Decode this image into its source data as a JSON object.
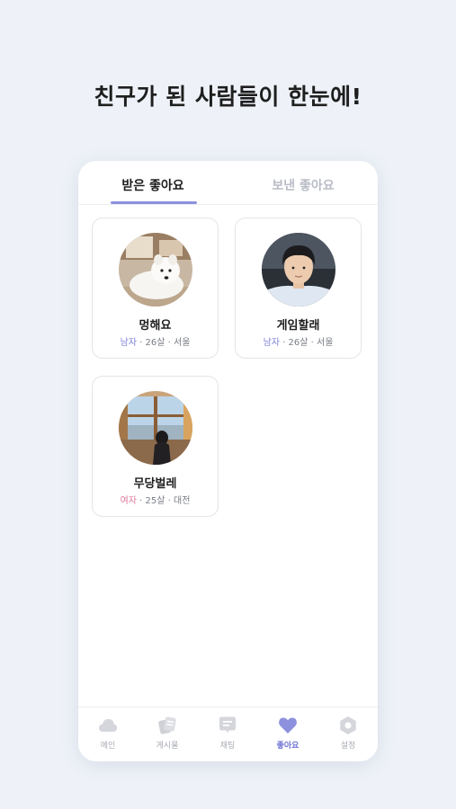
{
  "headline": "친구가 된 사람들이 한눈에!",
  "tabs": {
    "received": "받은 좋아요",
    "sent": "보낸 좋아요"
  },
  "cards": [
    {
      "name": "멍해요",
      "gender": "남자",
      "age": "26살",
      "city": "서울",
      "avatar": "samoyed-dog-photo"
    },
    {
      "name": "게임할래",
      "gender": "남자",
      "age": "26살",
      "city": "서울",
      "avatar": "young-man-car-photo"
    },
    {
      "name": "무당벌레",
      "gender": "여자",
      "age": "25살",
      "city": "대전",
      "avatar": "woman-window-view-photo"
    }
  ],
  "separator": "·",
  "nav": {
    "items": [
      {
        "label": "메인",
        "icon": "cloud-icon"
      },
      {
        "label": "게시물",
        "icon": "posts-icon"
      },
      {
        "label": "채팅",
        "icon": "chat-icon"
      },
      {
        "label": "좋아요",
        "icon": "heart-icon",
        "active": true
      },
      {
        "label": "설정",
        "icon": "hexagon-settings-icon"
      }
    ]
  },
  "colors": {
    "accent": "#8d91dd",
    "male": "#7c82d6",
    "female": "#e0789a",
    "background": "#eef2f8"
  }
}
